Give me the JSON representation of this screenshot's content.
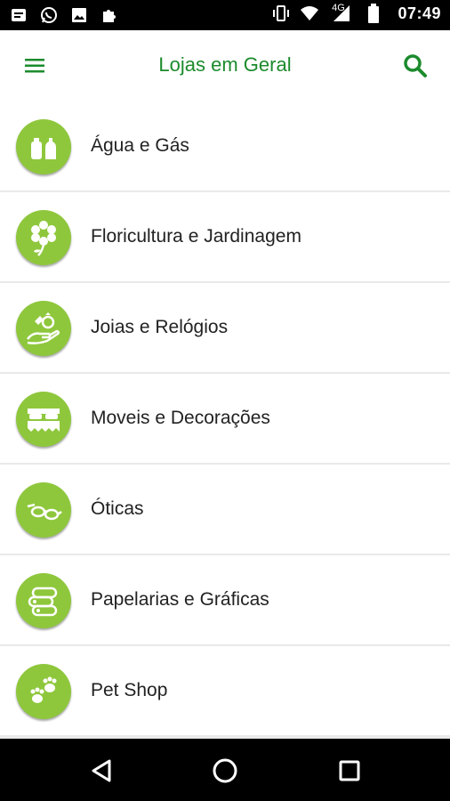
{
  "status_bar": {
    "time": "07:49",
    "network": "4G"
  },
  "app_bar": {
    "title": "Lojas em Geral",
    "menu_icon": "hamburger-menu-icon",
    "search_icon": "search-icon"
  },
  "categories": [
    {
      "label": "Água e Gás",
      "icon": "gas-bottle-icon"
    },
    {
      "label": "Floricultura e Jardinagem",
      "icon": "flower-icon"
    },
    {
      "label": "Joias e Relógios",
      "icon": "jewelry-icon"
    },
    {
      "label": "Moveis e Decorações",
      "icon": "bed-icon"
    },
    {
      "label": "Óticas",
      "icon": "glasses-icon"
    },
    {
      "label": "Papelarias e Gráficas",
      "icon": "paper-rolls-icon"
    },
    {
      "label": "Pet Shop",
      "icon": "paw-icon"
    }
  ],
  "colors": {
    "brand_green": "#1c8b2c",
    "icon_circle": "#8ec73c"
  }
}
